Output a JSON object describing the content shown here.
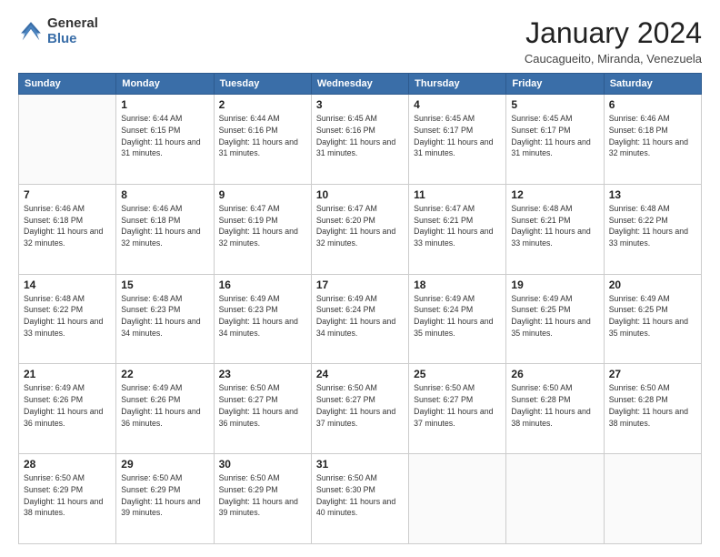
{
  "logo": {
    "general": "General",
    "blue": "Blue"
  },
  "header": {
    "title": "January 2024",
    "location": "Caucagueito, Miranda, Venezuela"
  },
  "weekdays": [
    "Sunday",
    "Monday",
    "Tuesday",
    "Wednesday",
    "Thursday",
    "Friday",
    "Saturday"
  ],
  "weeks": [
    [
      {
        "day": "",
        "sunrise": "",
        "sunset": "",
        "daylight": ""
      },
      {
        "day": "1",
        "sunrise": "Sunrise: 6:44 AM",
        "sunset": "Sunset: 6:15 PM",
        "daylight": "Daylight: 11 hours and 31 minutes."
      },
      {
        "day": "2",
        "sunrise": "Sunrise: 6:44 AM",
        "sunset": "Sunset: 6:16 PM",
        "daylight": "Daylight: 11 hours and 31 minutes."
      },
      {
        "day": "3",
        "sunrise": "Sunrise: 6:45 AM",
        "sunset": "Sunset: 6:16 PM",
        "daylight": "Daylight: 11 hours and 31 minutes."
      },
      {
        "day": "4",
        "sunrise": "Sunrise: 6:45 AM",
        "sunset": "Sunset: 6:17 PM",
        "daylight": "Daylight: 11 hours and 31 minutes."
      },
      {
        "day": "5",
        "sunrise": "Sunrise: 6:45 AM",
        "sunset": "Sunset: 6:17 PM",
        "daylight": "Daylight: 11 hours and 31 minutes."
      },
      {
        "day": "6",
        "sunrise": "Sunrise: 6:46 AM",
        "sunset": "Sunset: 6:18 PM",
        "daylight": "Daylight: 11 hours and 32 minutes."
      }
    ],
    [
      {
        "day": "7",
        "sunrise": "Sunrise: 6:46 AM",
        "sunset": "Sunset: 6:18 PM",
        "daylight": "Daylight: 11 hours and 32 minutes."
      },
      {
        "day": "8",
        "sunrise": "Sunrise: 6:46 AM",
        "sunset": "Sunset: 6:18 PM",
        "daylight": "Daylight: 11 hours and 32 minutes."
      },
      {
        "day": "9",
        "sunrise": "Sunrise: 6:47 AM",
        "sunset": "Sunset: 6:19 PM",
        "daylight": "Daylight: 11 hours and 32 minutes."
      },
      {
        "day": "10",
        "sunrise": "Sunrise: 6:47 AM",
        "sunset": "Sunset: 6:20 PM",
        "daylight": "Daylight: 11 hours and 32 minutes."
      },
      {
        "day": "11",
        "sunrise": "Sunrise: 6:47 AM",
        "sunset": "Sunset: 6:21 PM",
        "daylight": "Daylight: 11 hours and 33 minutes."
      },
      {
        "day": "12",
        "sunrise": "Sunrise: 6:48 AM",
        "sunset": "Sunset: 6:21 PM",
        "daylight": "Daylight: 11 hours and 33 minutes."
      },
      {
        "day": "13",
        "sunrise": "Sunrise: 6:48 AM",
        "sunset": "Sunset: 6:22 PM",
        "daylight": "Daylight: 11 hours and 33 minutes."
      }
    ],
    [
      {
        "day": "14",
        "sunrise": "Sunrise: 6:48 AM",
        "sunset": "Sunset: 6:22 PM",
        "daylight": "Daylight: 11 hours and 33 minutes."
      },
      {
        "day": "15",
        "sunrise": "Sunrise: 6:48 AM",
        "sunset": "Sunset: 6:23 PM",
        "daylight": "Daylight: 11 hours and 34 minutes."
      },
      {
        "day": "16",
        "sunrise": "Sunrise: 6:49 AM",
        "sunset": "Sunset: 6:23 PM",
        "daylight": "Daylight: 11 hours and 34 minutes."
      },
      {
        "day": "17",
        "sunrise": "Sunrise: 6:49 AM",
        "sunset": "Sunset: 6:24 PM",
        "daylight": "Daylight: 11 hours and 34 minutes."
      },
      {
        "day": "18",
        "sunrise": "Sunrise: 6:49 AM",
        "sunset": "Sunset: 6:24 PM",
        "daylight": "Daylight: 11 hours and 35 minutes."
      },
      {
        "day": "19",
        "sunrise": "Sunrise: 6:49 AM",
        "sunset": "Sunset: 6:25 PM",
        "daylight": "Daylight: 11 hours and 35 minutes."
      },
      {
        "day": "20",
        "sunrise": "Sunrise: 6:49 AM",
        "sunset": "Sunset: 6:25 PM",
        "daylight": "Daylight: 11 hours and 35 minutes."
      }
    ],
    [
      {
        "day": "21",
        "sunrise": "Sunrise: 6:49 AM",
        "sunset": "Sunset: 6:26 PM",
        "daylight": "Daylight: 11 hours and 36 minutes."
      },
      {
        "day": "22",
        "sunrise": "Sunrise: 6:49 AM",
        "sunset": "Sunset: 6:26 PM",
        "daylight": "Daylight: 11 hours and 36 minutes."
      },
      {
        "day": "23",
        "sunrise": "Sunrise: 6:50 AM",
        "sunset": "Sunset: 6:27 PM",
        "daylight": "Daylight: 11 hours and 36 minutes."
      },
      {
        "day": "24",
        "sunrise": "Sunrise: 6:50 AM",
        "sunset": "Sunset: 6:27 PM",
        "daylight": "Daylight: 11 hours and 37 minutes."
      },
      {
        "day": "25",
        "sunrise": "Sunrise: 6:50 AM",
        "sunset": "Sunset: 6:27 PM",
        "daylight": "Daylight: 11 hours and 37 minutes."
      },
      {
        "day": "26",
        "sunrise": "Sunrise: 6:50 AM",
        "sunset": "Sunset: 6:28 PM",
        "daylight": "Daylight: 11 hours and 38 minutes."
      },
      {
        "day": "27",
        "sunrise": "Sunrise: 6:50 AM",
        "sunset": "Sunset: 6:28 PM",
        "daylight": "Daylight: 11 hours and 38 minutes."
      }
    ],
    [
      {
        "day": "28",
        "sunrise": "Sunrise: 6:50 AM",
        "sunset": "Sunset: 6:29 PM",
        "daylight": "Daylight: 11 hours and 38 minutes."
      },
      {
        "day": "29",
        "sunrise": "Sunrise: 6:50 AM",
        "sunset": "Sunset: 6:29 PM",
        "daylight": "Daylight: 11 hours and 39 minutes."
      },
      {
        "day": "30",
        "sunrise": "Sunrise: 6:50 AM",
        "sunset": "Sunset: 6:29 PM",
        "daylight": "Daylight: 11 hours and 39 minutes."
      },
      {
        "day": "31",
        "sunrise": "Sunrise: 6:50 AM",
        "sunset": "Sunset: 6:30 PM",
        "daylight": "Daylight: 11 hours and 40 minutes."
      },
      {
        "day": "",
        "sunrise": "",
        "sunset": "",
        "daylight": ""
      },
      {
        "day": "",
        "sunrise": "",
        "sunset": "",
        "daylight": ""
      },
      {
        "day": "",
        "sunrise": "",
        "sunset": "",
        "daylight": ""
      }
    ]
  ]
}
